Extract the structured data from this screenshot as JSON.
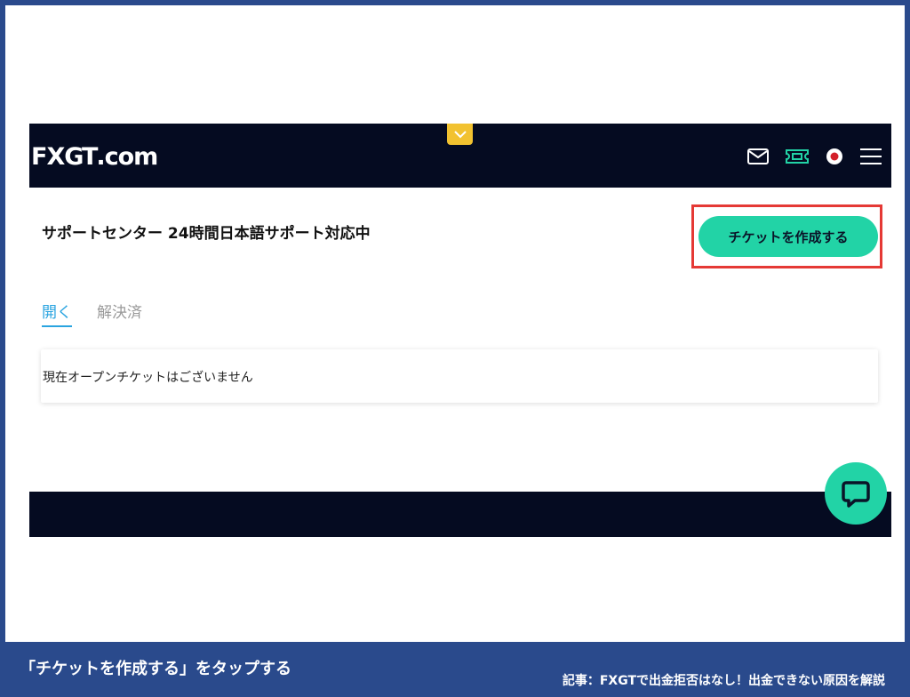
{
  "header": {
    "logo_text": "FXGT.com",
    "logo_parts": [
      "FX",
      "GT",
      ".com"
    ],
    "icons": [
      "mail-icon",
      "ticket-icon",
      "japan-flag-icon",
      "menu-icon"
    ]
  },
  "page": {
    "title": "サポートセンター 24時間日本語サポート対応中",
    "create_ticket_label": "チケットを作成する"
  },
  "tabs": [
    {
      "label": "開く",
      "active": true
    },
    {
      "label": "解決済",
      "active": false
    }
  ],
  "tickets": {
    "empty_message": "現在オープンチケットはございません"
  },
  "captions": {
    "instruction": "「チケットを作成する」をタップする",
    "article": "記事：FXGTで出金拒否はなし！出金できない原因を解説"
  },
  "colors": {
    "header_bg": "#050b21",
    "accent": "#22d3a6",
    "tab_active": "#2aa4e0",
    "highlight": "#e53935",
    "page_border": "#2a4a8c",
    "notice_tab": "#f2c230"
  }
}
